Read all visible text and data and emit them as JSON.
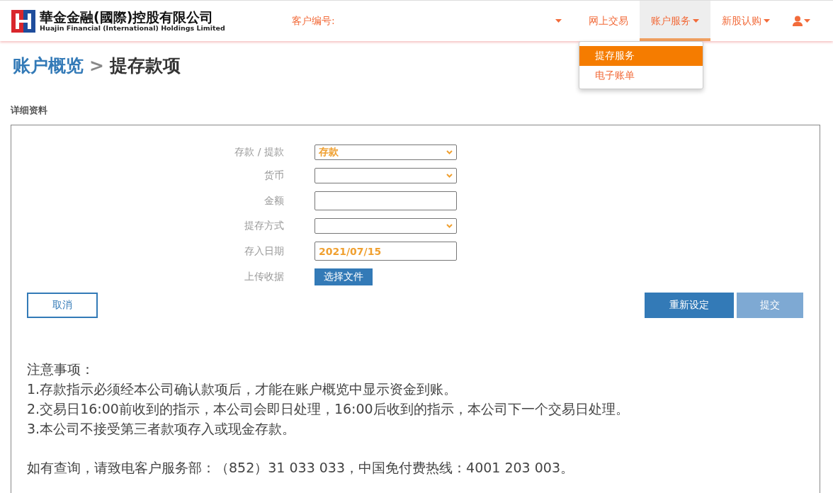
{
  "header": {
    "logo": {
      "name_zh": "華金金融(國際)控股有限公司",
      "name_en": "Huajin Financial (International) Holdings Limited"
    },
    "customer_label": "客户编号:",
    "nav": [
      {
        "label": "网上交易",
        "dropdown": false,
        "selected": false
      },
      {
        "label": "账户服务",
        "dropdown": true,
        "selected": true
      },
      {
        "label": "新股认购",
        "dropdown": true,
        "selected": false
      }
    ],
    "menu": [
      {
        "label": "提存服务",
        "selected": true
      },
      {
        "label": "电子账单",
        "selected": false
      }
    ]
  },
  "breadcrumb": {
    "parent": "账户概览",
    "separator": ">",
    "current": "提存款项"
  },
  "section_title": "详细资料",
  "form": {
    "fields": [
      {
        "kind": "select",
        "label": "存款 / 提款",
        "value": "存款"
      },
      {
        "kind": "select",
        "label": "货币"
      },
      {
        "kind": "input",
        "label": "金额"
      },
      {
        "kind": "select",
        "label": "提存方式"
      },
      {
        "kind": "input",
        "label": "存入日期",
        "value": "2021/07/15"
      },
      {
        "kind": "file",
        "label": "上传收据",
        "button": "选择文件"
      }
    ],
    "buttons": [
      {
        "kind": "outline",
        "label": "取消",
        "disabled": false
      },
      {
        "kind": "primary",
        "label": "重新设定",
        "disabled": false
      },
      {
        "kind": "primary",
        "label": "提交",
        "disabled": true
      }
    ]
  },
  "notes": {
    "title": "注意事项：",
    "lines": [
      "1.存款指示必须经本公司确认款项后，才能在账户概览中显示资金到账。",
      "2.交易日16:00前收到的指示，本公司会即日处理，16:00后收到的指示，本公司下一个交易日处理。",
      "3.本公司不接受第三者款项存入或现金存款。"
    ],
    "contact": "如有查询，请致电客户服务部：（852）31 033 033，中国免付费热线：4001 203 003。"
  }
}
